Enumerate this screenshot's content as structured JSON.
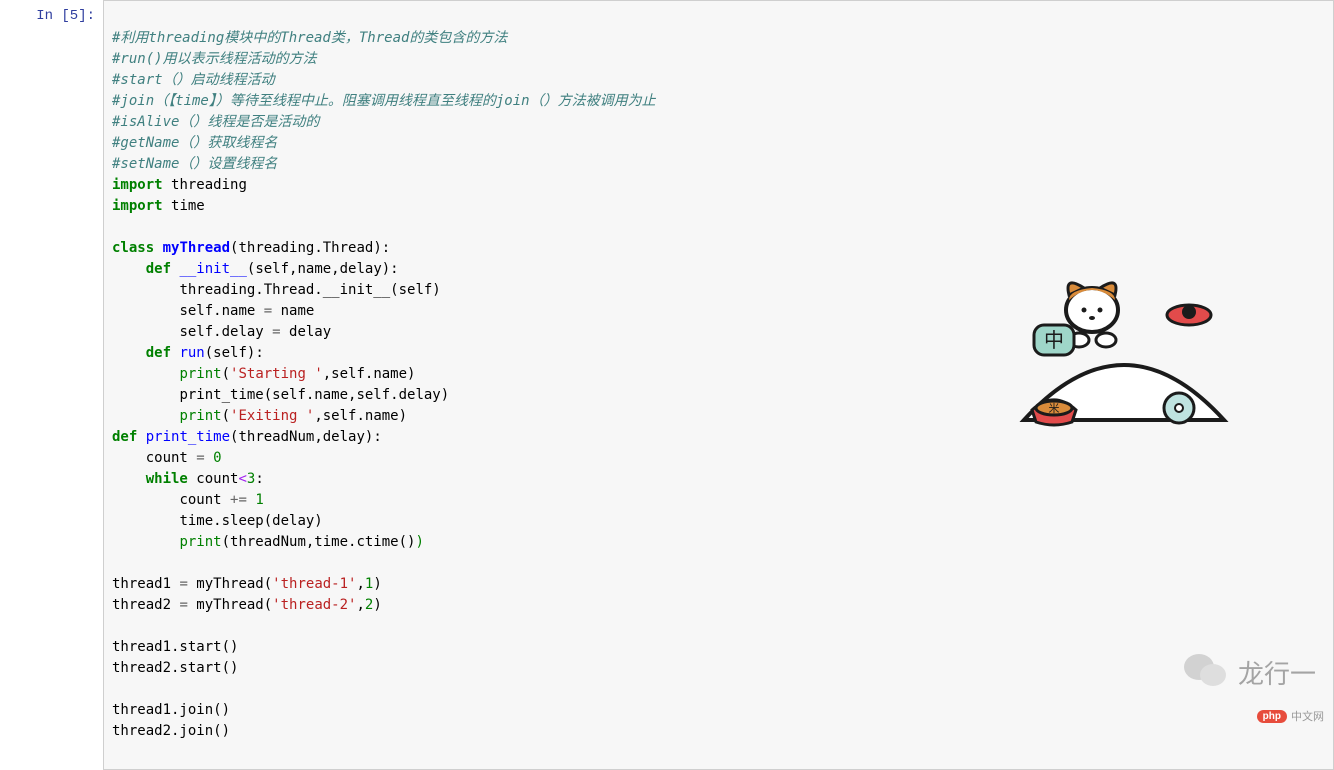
{
  "prompt": {
    "label": "In [5]:"
  },
  "code": {
    "c1": "#利用threading模块中的Thread类，Thread的类包含的方法",
    "c2": "#run()用以表示线程活动的方法",
    "c3": "#start（）启动线程活动",
    "c4": "#join（【time】）等待至线程中止。阻塞调用线程直至线程的join（）方法被调用为止",
    "c5": "#isAlive（）线程是否是活动的",
    "c6": "#getName（）获取线程名",
    "c7": "#setName（）设置线程名",
    "kw_import": "import",
    "mod_threading": "threading",
    "mod_time": "time",
    "kw_class": "class",
    "cls_name": "myThread",
    "cls_base_open": "(threading.Thread):",
    "kw_def": "def",
    "fn_init": "__init__",
    "init_args": "(self,name,delay):",
    "init_line1": "threading.Thread.__init__(self)",
    "init_line2a": "self.name ",
    "init_line2b": "=",
    "init_line2c": " name",
    "init_line3a": "self.delay ",
    "init_line3b": "=",
    "init_line3c": " delay",
    "fn_run": "run",
    "run_args": "(self):",
    "print_kw": "print",
    "str_starting": "'Starting '",
    "run_print1_rest": ",self.name)",
    "run_line2": "print_time(self.name,self.delay)",
    "str_exiting": "'Exiting '",
    "run_print3_rest": ",self.name)",
    "fn_print_time": "print_time",
    "pt_args": "(threadNum,delay):",
    "pt_l1a": "count ",
    "pt_l1b": "=",
    "pt_l1c": " ",
    "pt_l1d": "0",
    "kw_while": "while",
    "while_cond_a": " count",
    "while_lt": "<",
    "while_cond_b": "3",
    "while_colon": ":",
    "pt_l3a": "count ",
    "pt_l3b": "+=",
    "pt_l3c": " ",
    "pt_l3d": "1",
    "pt_l4": "time.sleep(delay)",
    "pt_l5_rest": "(threadNum,time.ctime()",
    "pt_l5_close": ")",
    "t1a": "thread1 ",
    "eq": "=",
    "t1b": " myThread(",
    "str_t1": "'thread-1'",
    "t1c": ",",
    "num1": "1",
    "t1d": ")",
    "t2a": "thread2 ",
    "t2b": " myThread(",
    "str_t2": "'thread-2'",
    "t2c": ",",
    "num2": "2",
    "t2d": ")",
    "s1": "thread1.start()",
    "s2": "thread2.start()",
    "j1": "thread1.join()",
    "j2": "thread2.join()"
  },
  "watermark": {
    "text": "龙行一"
  },
  "php_badge": {
    "pill": "php",
    "text": "中文网"
  },
  "mascot": {
    "bubble": "中"
  }
}
